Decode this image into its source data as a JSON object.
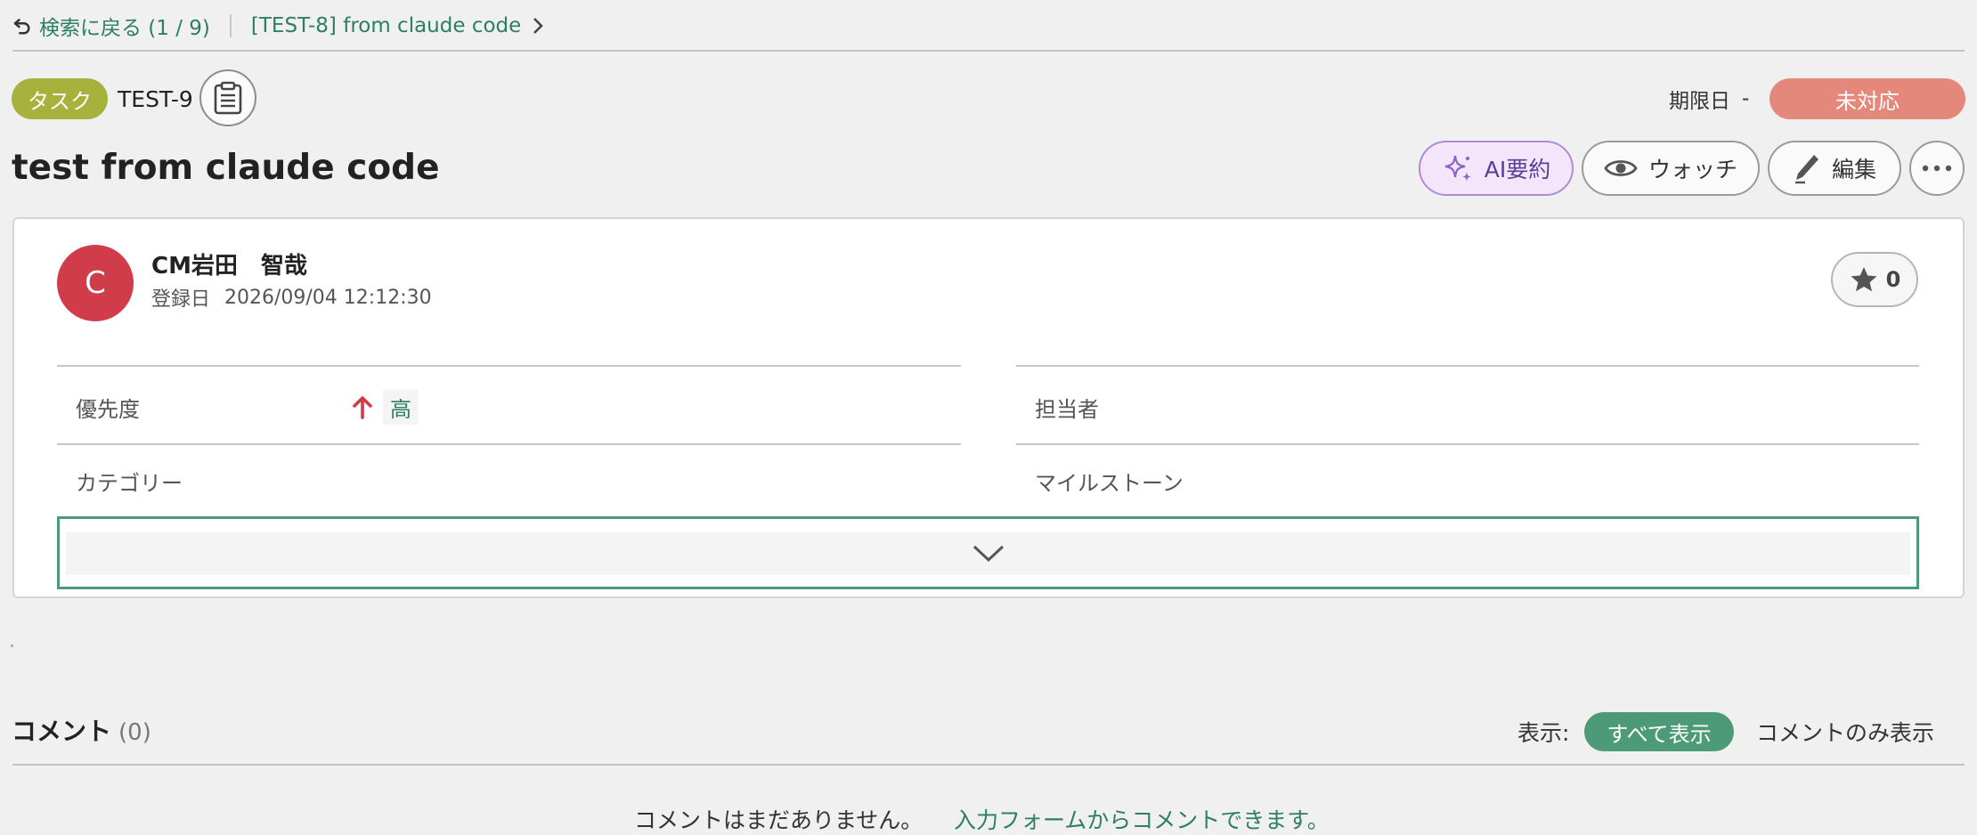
{
  "breadcrumb": {
    "back_label": "検索に戻る (1 / 9)",
    "parent_label": "[TEST-8] from claude code"
  },
  "issue": {
    "type": "タスク",
    "key": "TEST-9",
    "due_label": "期限日",
    "due_value": "-",
    "status": "未対応",
    "title": "test from claude code"
  },
  "actions": {
    "ai_summary": "AI要約",
    "watch": "ウォッチ",
    "edit": "編集"
  },
  "author": {
    "avatar_letter": "C",
    "name": "CM岩田　智哉",
    "created_label": "登録日",
    "created_date": "2026/09/04 12:12:30"
  },
  "star": {
    "count": "0"
  },
  "fields": {
    "priority_label": "優先度",
    "priority_value": "高",
    "assignee_label": "担当者",
    "category_label": "カテゴリー",
    "milestone_label": "マイルストーン"
  },
  "comments": {
    "title": "コメント",
    "count": "(0)",
    "view_label": "表示:",
    "view_all": "すべて表示",
    "view_comments_only": "コメントのみ表示",
    "empty_message": "コメントはまだありません。",
    "empty_link": "入力フォームからコメントできます。"
  },
  "colors": {
    "accent_green": "#4d9a79",
    "link_green": "#2d7f5f",
    "type_badge": "#a6b23c",
    "status_badge": "#e3887b",
    "avatar": "#d13c4b",
    "priority_arrow": "#d13c4b"
  },
  "icons": {
    "back": "undo-arrow-icon",
    "breadcrumb_chevron": "chevron-right-icon",
    "clipboard": "clipboard-icon",
    "ai": "sparkle-icon",
    "watch": "eye-icon",
    "edit": "pen-icon",
    "more": "ellipsis-icon",
    "star": "star-icon",
    "priority": "arrow-up-icon",
    "expand": "chevron-down-icon"
  }
}
